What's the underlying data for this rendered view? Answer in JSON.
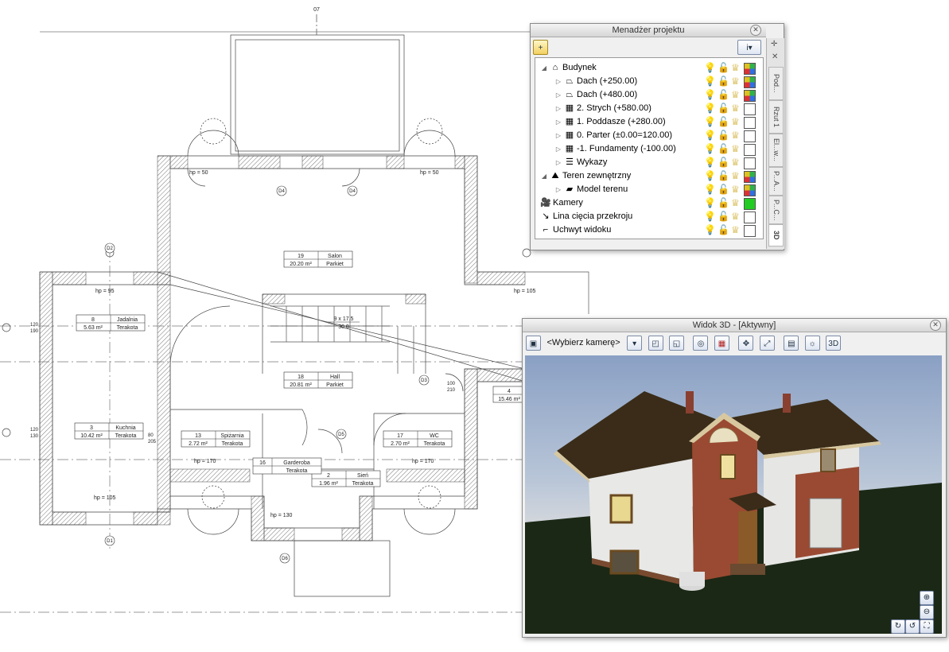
{
  "plan": {
    "top_marker": "07",
    "rooms": [
      {
        "num": "19",
        "name": "Salon",
        "area": "20.20 m²",
        "floor": "Parkiet"
      },
      {
        "num": "8",
        "name": "Jadalnia",
        "area": "5.63 m²",
        "floor": "Terakota"
      },
      {
        "num": "18",
        "name": "Hall",
        "area": "20.81 m²",
        "floor": "Parkiet"
      },
      {
        "num": "3",
        "name": "Kuchnia",
        "area": "10.42 m²",
        "floor": "Terakota"
      },
      {
        "num": "13",
        "name": "Spiżarnia",
        "area": "2.72 m²",
        "floor": "Terakota"
      },
      {
        "num": "17",
        "name": "WC",
        "area": "2.70 m²",
        "floor": "Terakota"
      },
      {
        "num": "2",
        "name": "Sień",
        "area": "1.96 m²",
        "floor": "Terakota"
      },
      {
        "num": "16",
        "name": "Garderoba",
        "area": "",
        "floor": "Terakota"
      },
      {
        "num": "4",
        "name": "",
        "area": "15.46 m²",
        "floor": ""
      }
    ],
    "stairs": {
      "steps": "9 x 17.5",
      "tread": "30.0"
    },
    "hp_labels": [
      "hp = 50",
      "hp = 50",
      "hp = 95",
      "hp = 105",
      "hp = 170",
      "hp = 170",
      "hp = 105",
      "hp = 130"
    ],
    "door_tags": [
      "D4",
      "D4",
      "D3",
      "D5",
      "D6",
      "D2",
      "D1"
    ],
    "side_dims": [
      {
        "a": "120",
        "b": "190"
      },
      {
        "a": "120",
        "b": "130"
      },
      {
        "a": "100",
        "b": "210"
      },
      {
        "a": "80",
        "b": "205"
      }
    ]
  },
  "project_manager": {
    "title": "Menadżer projektu",
    "tabs": [
      "Pod...",
      "Rzut 1",
      "El...w...",
      "P...A...",
      "P...C...",
      "3D"
    ],
    "tree": [
      {
        "level": 0,
        "expander": "open",
        "icon": "house-icon",
        "label": "Budynek",
        "color": "multi"
      },
      {
        "level": 1,
        "expander": "closed",
        "icon": "roof-icon",
        "label": "Dach (+250.00)",
        "color": "multi"
      },
      {
        "level": 1,
        "expander": "closed",
        "icon": "roof-icon",
        "label": "Dach (+480.00)",
        "color": "multi"
      },
      {
        "level": 1,
        "expander": "closed",
        "icon": "storey-icon",
        "label": "2. Strych (+580.00)",
        "color": "none"
      },
      {
        "level": 1,
        "expander": "closed",
        "icon": "storey-icon",
        "label": "1. Poddasze (+280.00)",
        "color": "none"
      },
      {
        "level": 1,
        "expander": "closed",
        "icon": "storey-icon",
        "label": "0. Parter (±0.00=120.00)",
        "color": "none"
      },
      {
        "level": 1,
        "expander": "closed",
        "icon": "storey-icon",
        "label": "-1. Fundamenty (-100.00)",
        "color": "none"
      },
      {
        "level": 1,
        "expander": "closed",
        "icon": "list-icon",
        "label": "Wykazy",
        "color": "none"
      },
      {
        "level": 0,
        "expander": "open",
        "icon": "terrain-icon",
        "label": "Teren zewnętrzny",
        "color": "multi"
      },
      {
        "level": 1,
        "expander": "closed",
        "icon": "terrain-model-icon",
        "label": "Model terenu",
        "color": "multi"
      },
      {
        "level": 0,
        "expander": "none",
        "icon": "camera-icon",
        "label": "Kamery",
        "color": "green"
      },
      {
        "level": 0,
        "expander": "none",
        "icon": "section-line-icon",
        "label": "Lina cięcia przekroju",
        "color": "none"
      },
      {
        "level": 0,
        "expander": "none",
        "icon": "view-handle-icon",
        "label": "Uchwyt widoku",
        "color": "none"
      }
    ]
  },
  "view3d": {
    "title": "Widok 3D - [Aktywny]",
    "camera_select": "<Wybierz kamerę>"
  },
  "colors": {
    "accent_green": "#22cc22",
    "sky": "#a9b9d2",
    "ground": "#1a2614",
    "roof": "#3a2c18",
    "brick": "#9a4a32"
  }
}
